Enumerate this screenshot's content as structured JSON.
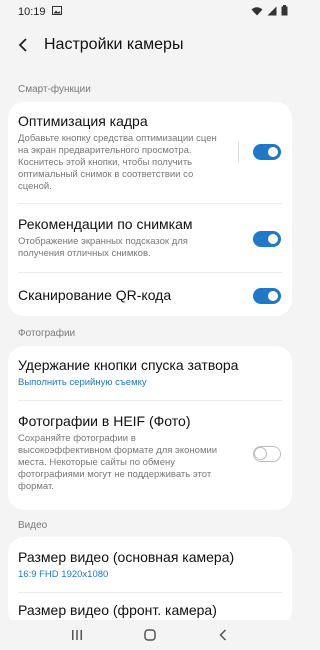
{
  "status_bar": {
    "time": "10:19"
  },
  "header": {
    "title": "Настройки камеры"
  },
  "sections": {
    "smart": "Смарт-функции",
    "photos": "Фотографии",
    "video": "Видео"
  },
  "smart_items": {
    "frame_opt": {
      "title": "Оптимизация кадра",
      "desc": "Добавьте кнопку средства оптимизации сцен на экран предварительного просмотра. Коснитесь этой кнопки, чтобы получить оптимальный снимок в соответствии со сценой."
    },
    "shot_tips": {
      "title": "Рекомендации по снимкам",
      "desc": "Отображение экранных подсказок для получения отличных снимков."
    },
    "qr": {
      "title": "Сканирование QR-кода"
    }
  },
  "photo_items": {
    "hold_shutter": {
      "title": "Удержание кнопки спуска затвора",
      "value": "Выполнить серийную съемку"
    },
    "heif": {
      "title": "Фотографии в HEIF (Фото)",
      "desc": "Сохраняйте фотографии в высокоэффективном формате для экономии места. Некоторые сайты по обмену фотографиями могут не поддерживать этот формат."
    }
  },
  "video_items": {
    "rear_size": {
      "title": "Размер видео (основная камера)",
      "value": "16:9 FHD 1920x1080"
    },
    "front_size": {
      "title": "Размер видео (фронт. камера)"
    }
  },
  "toggles": {
    "frame_opt": true,
    "shot_tips": true,
    "qr": true,
    "heif": false
  },
  "colors": {
    "accent": "#1f78c8",
    "background": "#f4f4f4",
    "card": "#ffffff"
  }
}
